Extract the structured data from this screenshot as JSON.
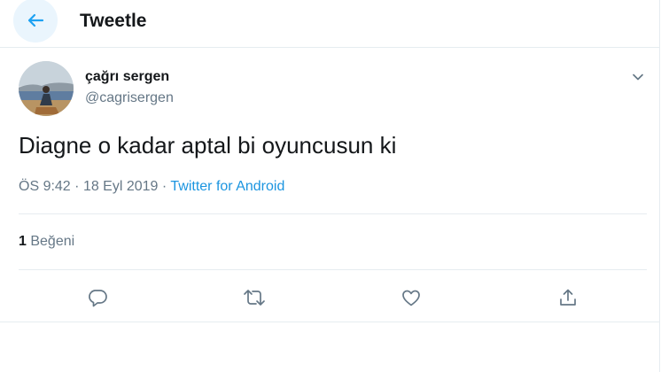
{
  "header": {
    "title": "Tweetle"
  },
  "tweet": {
    "display_name": "çağrı sergen",
    "handle": "@cagrisergen",
    "text": "Diagne o kadar aptal bi oyuncusun ki",
    "time": "ÖS 9:42",
    "date": "18 Eyl 2019",
    "separator": "·",
    "source": "Twitter for Android",
    "likes_count": "1",
    "likes_label": "Beğeni"
  },
  "icons": {
    "back": "arrow-left-icon",
    "caret": "chevron-down-icon",
    "reply": "reply-icon",
    "retweet": "retweet-icon",
    "like": "heart-icon",
    "share": "share-icon"
  },
  "colors": {
    "accent": "#1da1f2",
    "text": "#14171a",
    "secondary": "#657786",
    "link": "#1b95e0",
    "border": "#e6ecf0"
  }
}
